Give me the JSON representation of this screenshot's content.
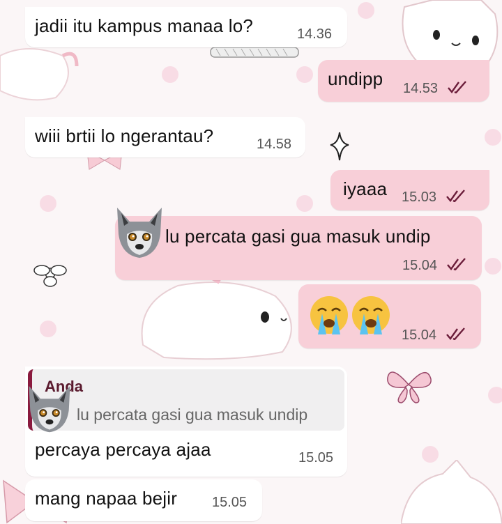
{
  "colors": {
    "incoming_bubble": "#ffffff",
    "outgoing_bubble": "#f8cfd8",
    "read_ticks": "#6b1d3a",
    "quote_bar": "#8a1a3e",
    "wallpaper": "#fbf6f7"
  },
  "messages": [
    {
      "direction": "incoming",
      "text": "jadii itu kampus manaa lo?",
      "time": "14.36"
    },
    {
      "direction": "outgoing",
      "text": "undipp",
      "time": "14.53",
      "status": "read"
    },
    {
      "direction": "incoming",
      "text": "wiii brtii lo ngerantau?",
      "time": "14.58"
    },
    {
      "direction": "outgoing",
      "text": "iyaaa",
      "time": "15.03",
      "status": "read"
    },
    {
      "direction": "outgoing",
      "text": "lu percata gasi gua masuk undip",
      "time": "15.04",
      "status": "read",
      "sticker": "wolf-avatar"
    },
    {
      "direction": "outgoing",
      "emoji": "loudly-crying-face x2",
      "time": "15.04",
      "status": "read"
    },
    {
      "direction": "incoming",
      "quote": {
        "author": "Anda",
        "text": "lu percata gasi gua masuk undip"
      },
      "text": "percaya percaya ajaa",
      "time": "15.05"
    },
    {
      "direction": "incoming",
      "text": "mang napaa bejir",
      "time": "15.05"
    }
  ]
}
